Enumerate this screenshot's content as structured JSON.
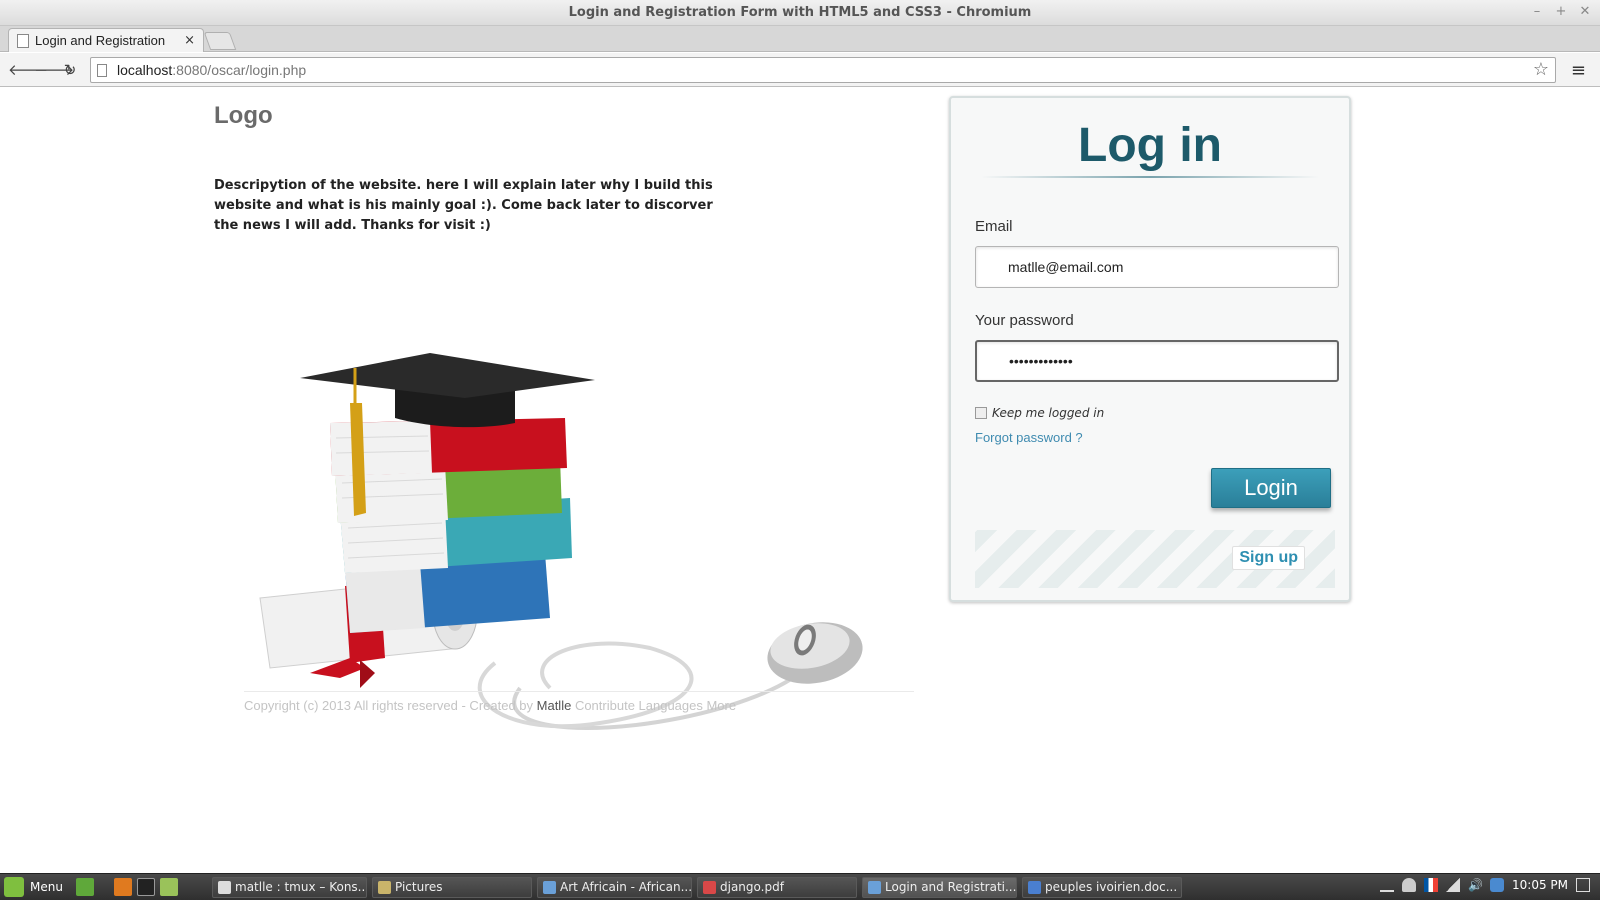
{
  "window": {
    "title": "Login and Registration Form with HTML5 and CSS3 - Chromium",
    "controls": [
      "–",
      "+",
      "✕"
    ]
  },
  "tab": {
    "label": "Login and Registration",
    "close": "×"
  },
  "toolbar": {
    "back": "🡐",
    "forward": "🡒",
    "reload": "↻",
    "url_host": "localhost",
    "url_rest": ":8080/oscar/login.php",
    "star": "☆",
    "menu": "≡"
  },
  "page": {
    "logo": "Logo",
    "description": "Descripytion of the website. here I will explain later why I build this website and what is his mainly goal :). Come back later to discorver the news I will add. Thanks for visit :)",
    "footer": {
      "prefix": "Copyright (c) 2013 All rights reserved - Created by ",
      "author": "Matlle",
      "links": " Contribute Languages More"
    }
  },
  "login": {
    "heading": "Log in",
    "email_label": "Email",
    "email_value": "matlle@email.com",
    "password_label": "Your password",
    "password_value": "•••••••••••••",
    "remember_label": "Keep me logged in",
    "forgot_link": "Forgot password ?",
    "login_button": "Login",
    "signup_button": "Sign up",
    "accent_color": "#2a8aa8"
  },
  "taskbar": {
    "menu_label": "Menu",
    "windows": [
      {
        "label": "matlle : tmux – Kons...",
        "icon": "terminal-icon"
      },
      {
        "label": "Pictures",
        "icon": "folder-icon"
      },
      {
        "label": "Art Africain - African...",
        "icon": "chromium-icon"
      },
      {
        "label": "django.pdf",
        "icon": "pdf-icon"
      },
      {
        "label": "Login and Registrati...",
        "icon": "chromium-icon"
      },
      {
        "label": "peuples ivoirien.doc...",
        "icon": "document-icon"
      }
    ],
    "clock": "10:05 PM"
  }
}
